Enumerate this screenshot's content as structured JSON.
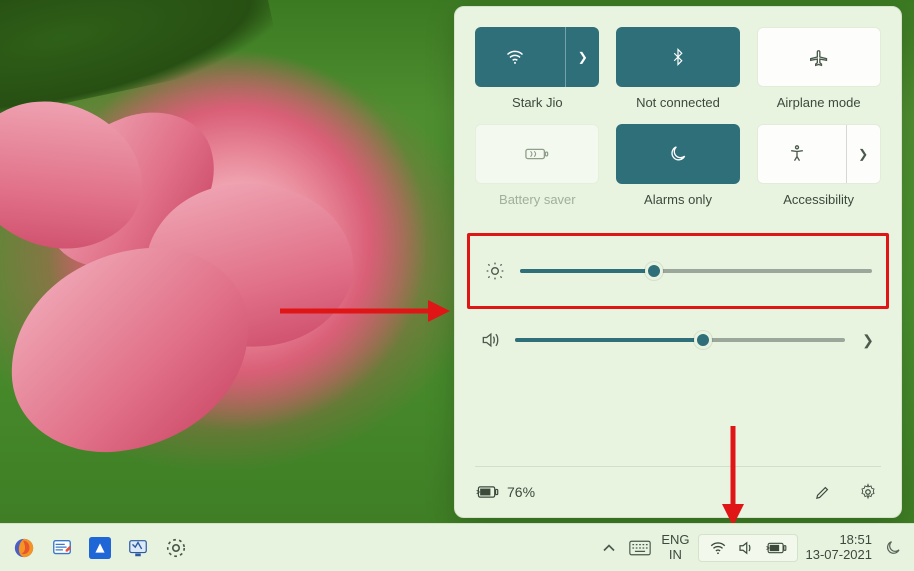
{
  "tiles": {
    "wifi": {
      "label": "Stark Jio",
      "state": "on"
    },
    "bluetooth": {
      "label": "Not connected",
      "state": "on"
    },
    "airplane": {
      "label": "Airplane mode",
      "state": "off"
    },
    "battery_saver": {
      "label": "Battery saver",
      "state": "disabled"
    },
    "focus": {
      "label": "Alarms only",
      "state": "on"
    },
    "accessibility": {
      "label": "Accessibility",
      "state": "off"
    }
  },
  "sliders": {
    "brightness": {
      "value": 38
    },
    "volume": {
      "value": 57
    }
  },
  "battery": {
    "percent_label": "76%"
  },
  "taskbar": {
    "language": {
      "line1": "ENG",
      "line2": "IN"
    },
    "clock": {
      "time": "18:51",
      "date": "13-07-2021"
    }
  },
  "colors": {
    "accent": "#2f6f7a",
    "panel": "#e8f3e0",
    "highlight": "#e01515"
  }
}
